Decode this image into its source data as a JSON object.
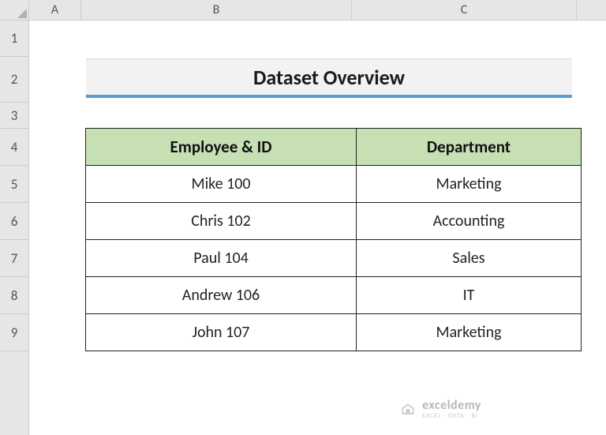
{
  "columns": [
    "A",
    "B",
    "C"
  ],
  "rows": [
    "1",
    "2",
    "3",
    "4",
    "5",
    "6",
    "7",
    "8",
    "9"
  ],
  "title": "Dataset Overview",
  "table": {
    "headers": [
      "Employee & ID",
      "Department"
    ],
    "rows": [
      [
        "Mike 100",
        "Marketing"
      ],
      [
        "Chris 102",
        "Accounting"
      ],
      [
        "Paul 104",
        "Sales"
      ],
      [
        "Andrew 106",
        "IT"
      ],
      [
        "John 107",
        "Marketing"
      ]
    ]
  },
  "watermark": {
    "brand": "exceldemy",
    "tag": "EXCEL · DATA · BI"
  }
}
